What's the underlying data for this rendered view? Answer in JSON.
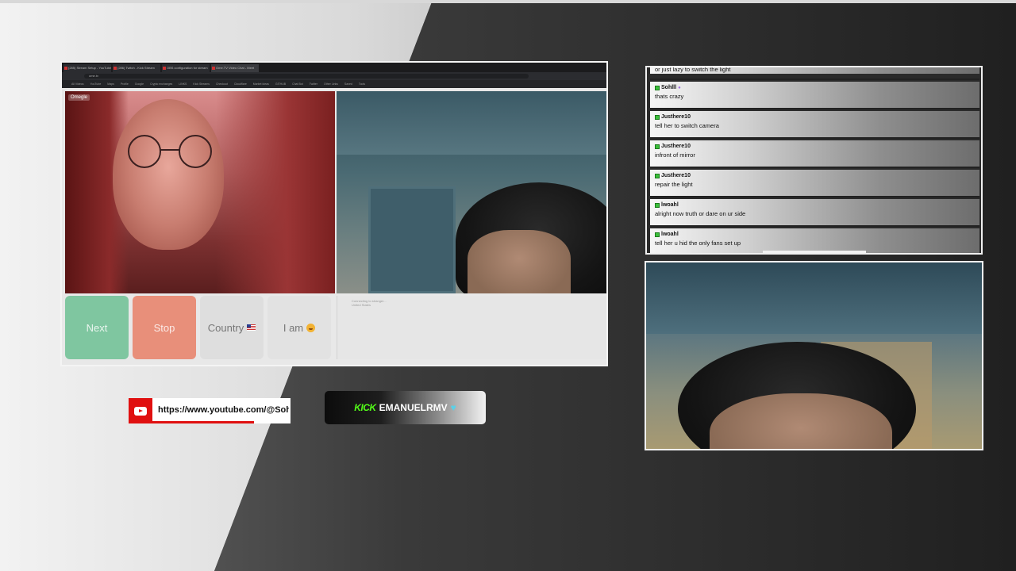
{
  "browser": {
    "tabs": [
      "(285) Stream Setup - YouTube",
      "(286) Twitch - Kick Stream",
      "OBS configuration for stream",
      "Ome.TV Video Chat - Meet"
    ],
    "url": "ome.tv",
    "bookmarks": [
      "All Videos",
      "YouTube",
      "Maps",
      "Profile",
      "Google",
      "Crypto exchanges",
      "LINKS",
      "Kick Streams",
      "Checkout",
      "Cloudflare",
      "Market ideas",
      "GITHUB",
      "Chat Bot",
      "Twitter",
      "Other Links",
      "Saved",
      "Tools"
    ],
    "site_logo": "Omegle"
  },
  "controls": {
    "next_label": "Next",
    "stop_label": "Stop",
    "country_label": "Country",
    "iam_label": "I am"
  },
  "chat_mini": {
    "line1": "Connecting to stranger...",
    "line2": "United States"
  },
  "chat": {
    "top_partial": "or just lazy to switch the light",
    "messages": [
      {
        "user": "Sohlll",
        "text": "thats crazy"
      },
      {
        "user": "Justhere10",
        "text": "tell her to switch camera"
      },
      {
        "user": "Justhere10",
        "text": "infront of mirror"
      },
      {
        "user": "Justhere10",
        "text": "repair the light"
      },
      {
        "user": "lwoahl",
        "text": "alright now truth or dare on ur side"
      },
      {
        "user": "lwoahl",
        "text": "tell her u hid the only fans set up"
      }
    ]
  },
  "youtube": {
    "url_text": "https://www.youtube.com/@Sohll"
  },
  "kick": {
    "logo_text": "KICK",
    "channel": "EMANUELRMV",
    "heart": "♥"
  },
  "colors": {
    "next_button": "#7fc6a0",
    "stop_button": "#e88f7a",
    "kick_green": "#53fc18",
    "youtube_red": "#e01010",
    "chat_badge": "#3bbf3b"
  }
}
